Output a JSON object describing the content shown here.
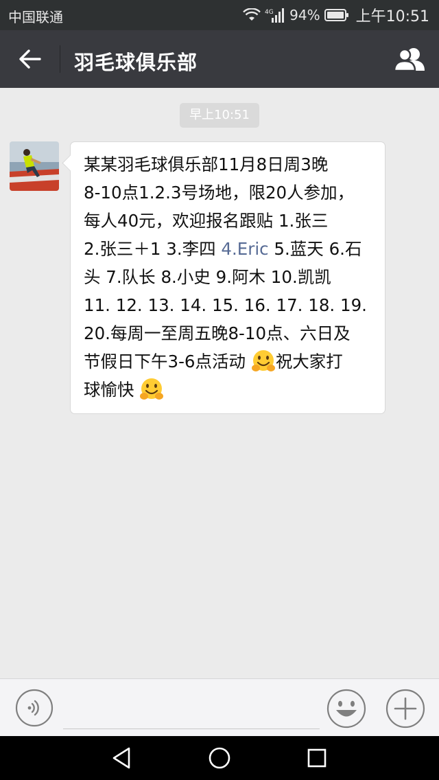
{
  "status_bar": {
    "carrier": "中国联通",
    "network": "4G",
    "battery": "94%",
    "time": "上午10:51"
  },
  "header": {
    "title": "羽毛球俱乐部",
    "back_icon": "arrow-left-icon",
    "members_icon": "group-members-icon"
  },
  "chat": {
    "timestamp": "早上10:51",
    "message": {
      "lines": [
        "某某羽毛球俱乐部11月8日周3晚",
        "8-10点1.2.3号场地，限20人参加，",
        "每人40元，欢迎报名跟贴 1.张三",
        "2.张三＋1 3.李四 ",
        " 5.蓝天 6.石",
        "头 7.队长 8.小史 9.阿木 10.凯凯",
        "11. 12. 13. 14. 15. 16. 17. 18. 19.",
        "20.每周一至周五晚8-10点、六日及",
        "节假日下午3-6点活动 ",
        "祝大家打",
        "球愉快 "
      ],
      "mention": "4.Eric",
      "emoji": "hugging-face-emoji"
    }
  },
  "input_bar": {
    "voice_icon": "voice-icon",
    "input_value": "",
    "emoji_icon": "smiley-icon",
    "more_icon": "plus-icon"
  },
  "system_nav": {
    "back_icon": "triangle-back-icon",
    "home_icon": "circle-home-icon",
    "recents_icon": "square-recents-icon"
  },
  "colors": {
    "status_bar_bg": "#2e3132",
    "nav_bar_bg": "#393a3f",
    "chat_bg": "#ebebeb",
    "mention_link": "#576b95",
    "bubble_bg": "#ffffff"
  }
}
